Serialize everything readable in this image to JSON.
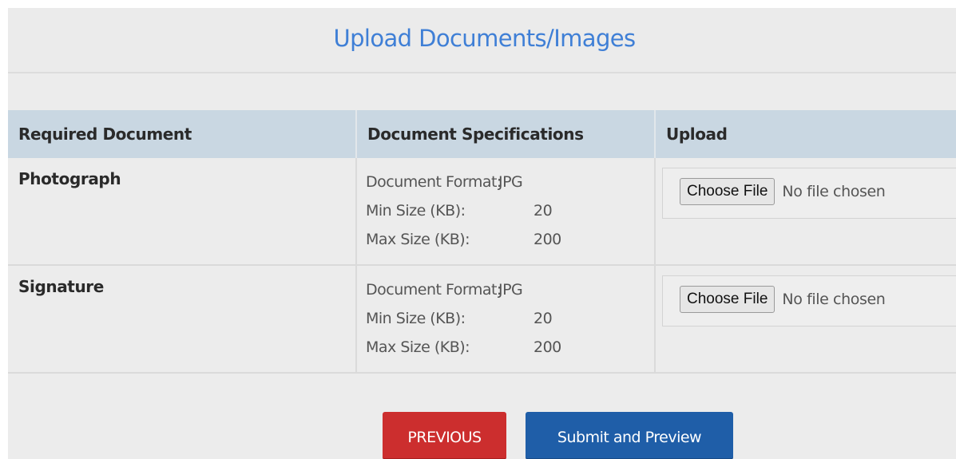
{
  "header": {
    "title": "Upload Documents/Images"
  },
  "table": {
    "columns": [
      "Required Document",
      "Document Specifications",
      "Upload"
    ],
    "rows": [
      {
        "document": "Photograph",
        "specs": [
          {
            "label": "Document Format:",
            "value": "JPG"
          },
          {
            "label": "Min Size (KB):",
            "value": "20"
          },
          {
            "label": "Max Size (KB):",
            "value": "200"
          }
        ],
        "upload": {
          "button_label": "Choose File",
          "status": "No file chosen"
        }
      },
      {
        "document": "Signature",
        "specs": [
          {
            "label": "Document Format:",
            "value": "JPG"
          },
          {
            "label": "Min Size (KB):",
            "value": "20"
          },
          {
            "label": "Max Size (KB):",
            "value": "200"
          }
        ],
        "upload": {
          "button_label": "Choose File",
          "status": "No file chosen"
        }
      }
    ]
  },
  "actions": {
    "previous_label": "PREVIOUS",
    "submit_label": "Submit and Preview"
  },
  "colors": {
    "title": "#3f7fd6",
    "header_row": "#c9d7e2",
    "previous_button": "#cc2e2e",
    "submit_button": "#1f5ea8"
  }
}
